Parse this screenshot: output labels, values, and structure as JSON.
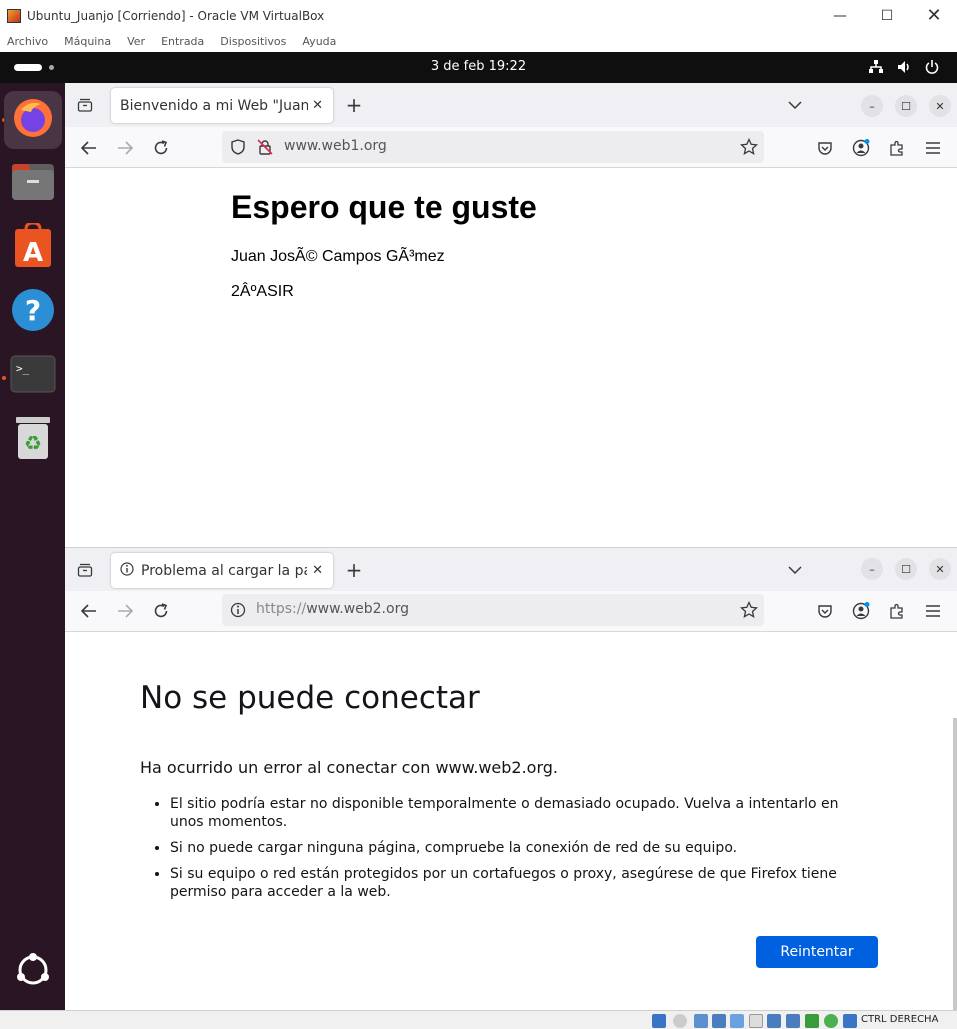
{
  "vbox": {
    "title": "Ubuntu_Juanjo [Corriendo] - Oracle VM VirtualBox",
    "menu": [
      "Archivo",
      "Máquina",
      "Ver",
      "Entrada",
      "Dispositivos",
      "Ayuda"
    ],
    "status_key": "CTRL DERECHA"
  },
  "topbar": {
    "clock": "3 de feb  19:22"
  },
  "dock": {
    "items": [
      "firefox-icon",
      "files-icon",
      "app-center-icon",
      "help-icon",
      "terminal-icon",
      "trash-icon",
      "show-apps-icon"
    ]
  },
  "window1": {
    "tab_title": "Bienvenido a mi Web \"Juanjo",
    "url": "www.web1.org",
    "page": {
      "heading": "Espero que te guste",
      "line1": "Juan JosÃ© Campos GÃ³mez",
      "line2": "2ÂºASIR"
    }
  },
  "window2": {
    "tab_title": "Problema al cargar la pági",
    "url_prefix": "https://",
    "url_host": "www.web2.org",
    "page": {
      "heading": "No se puede conectar",
      "intro": "Ha ocurrido un error al conectar con www.web2.org.",
      "bullets": [
        "El sitio podría estar no disponible temporalmente o demasiado ocupado. Vuelva a intentarlo en unos momentos.",
        "Si no puede cargar ninguna página, compruebe la conexión de red de su equipo.",
        "Si su equipo o red están protegidos por un cortafuegos o proxy, asegúrese de que Firefox tiene permiso para acceder a la web."
      ],
      "retry_label": "Reintentar"
    }
  },
  "colors": {
    "ubuntu_orange": "#e95420",
    "dock_bg": "#2a1524",
    "retry_blue": "#0061e0"
  }
}
